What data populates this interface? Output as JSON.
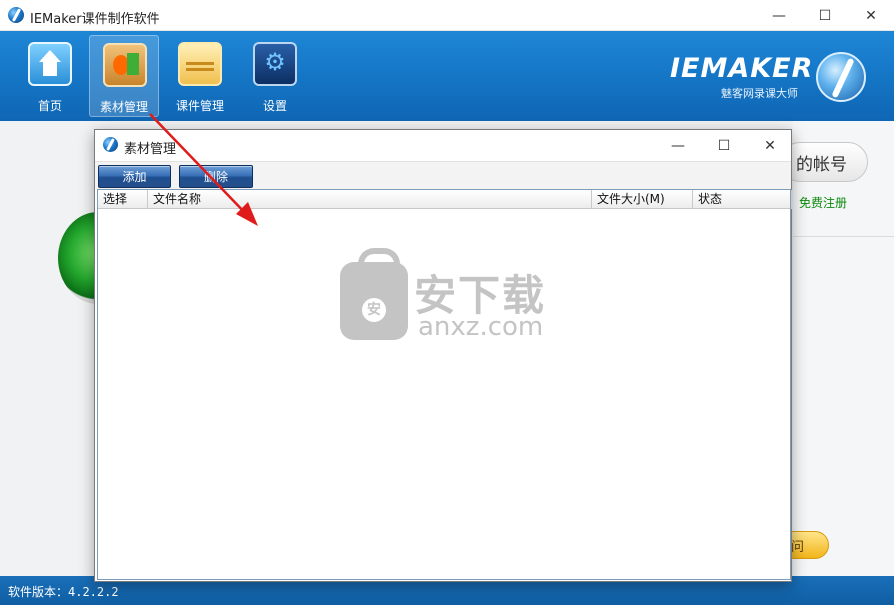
{
  "window": {
    "title": "IEMaker课件制作软件",
    "minimize_glyph": "—",
    "maximize_glyph": "☐",
    "close_glyph": "✕"
  },
  "nav": {
    "items": [
      {
        "label": "首页",
        "icon": "home-icon"
      },
      {
        "label": "素材管理",
        "icon": "material-icon",
        "active": true
      },
      {
        "label": "课件管理",
        "icon": "folder-icon"
      },
      {
        "label": "设置",
        "icon": "settings-icon"
      }
    ]
  },
  "brand": {
    "name": "IEMAKER",
    "subtitle": "魅客网录课大师"
  },
  "right_panel": {
    "account_button": "的帐号",
    "register_link": "免费注册",
    "gold_button": "问"
  },
  "status": {
    "version": "软件版本：4.2.2.2"
  },
  "dialog": {
    "title": "素材管理",
    "minimize_glyph": "—",
    "maximize_glyph": "☐",
    "close_glyph": "✕",
    "add_button": "添加",
    "delete_button": "删除",
    "columns": [
      "选择",
      "文件名称",
      "文件大小(M)",
      "状态"
    ]
  },
  "watermark": {
    "badge": "安",
    "cn": "安下载",
    "en": "anxz.com"
  },
  "colors": {
    "header_blue": "#1576c6",
    "status_blue": "#1a6fb9",
    "register_green": "#0a8a0a",
    "arrow_red": "#e01b1b"
  }
}
